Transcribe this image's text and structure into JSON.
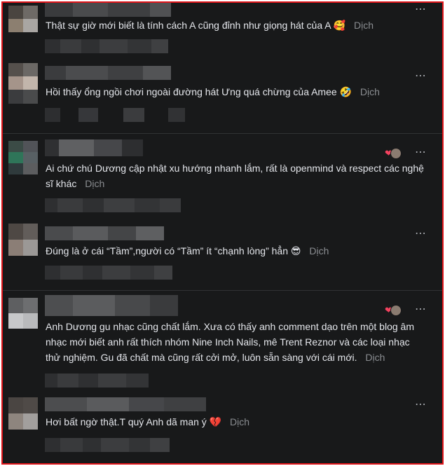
{
  "more_icon": "⋯",
  "translate_label": "Dịch",
  "reaction_icons": [
    "heart-icon",
    "face-icon"
  ],
  "comments": [
    {
      "text": "Thật sự giờ mới biết là tính cách A cũng đỉnh như giọng hát của A",
      "emoji": "🥰"
    },
    {
      "text": "Hồi thấy ổng ngồi chơi ngoài đường hát Ưng quá chừng của Amee",
      "emoji": "🤣"
    },
    {
      "text": "Ai chứ chú Dương cập nhật xu hướng nhanh lắm, rất là openmind và respect các nghệ sĩ khác",
      "emoji": ""
    },
    {
      "text": "Đúng là ở cái “Tầm”,người có “Tầm” ít “chạnh lòng” hẳn",
      "emoji": "😎"
    },
    {
      "text": "Anh Dương gu nhạc cũng chất lắm. Xưa có thấy anh comment dạo trên một blog âm nhạc mới biết anh rất thích nhóm Nine Inch Nails, mê Trent Reznor và các loại nhạc thử nghiệm. Gu đã chất mà cũng rất cởi mở, luôn sẵn sàng với cái mới.",
      "emoji": ""
    },
    {
      "text": "Hơi bất ngờ thật.T quý Anh dã man ý",
      "emoji": "💔"
    }
  ]
}
